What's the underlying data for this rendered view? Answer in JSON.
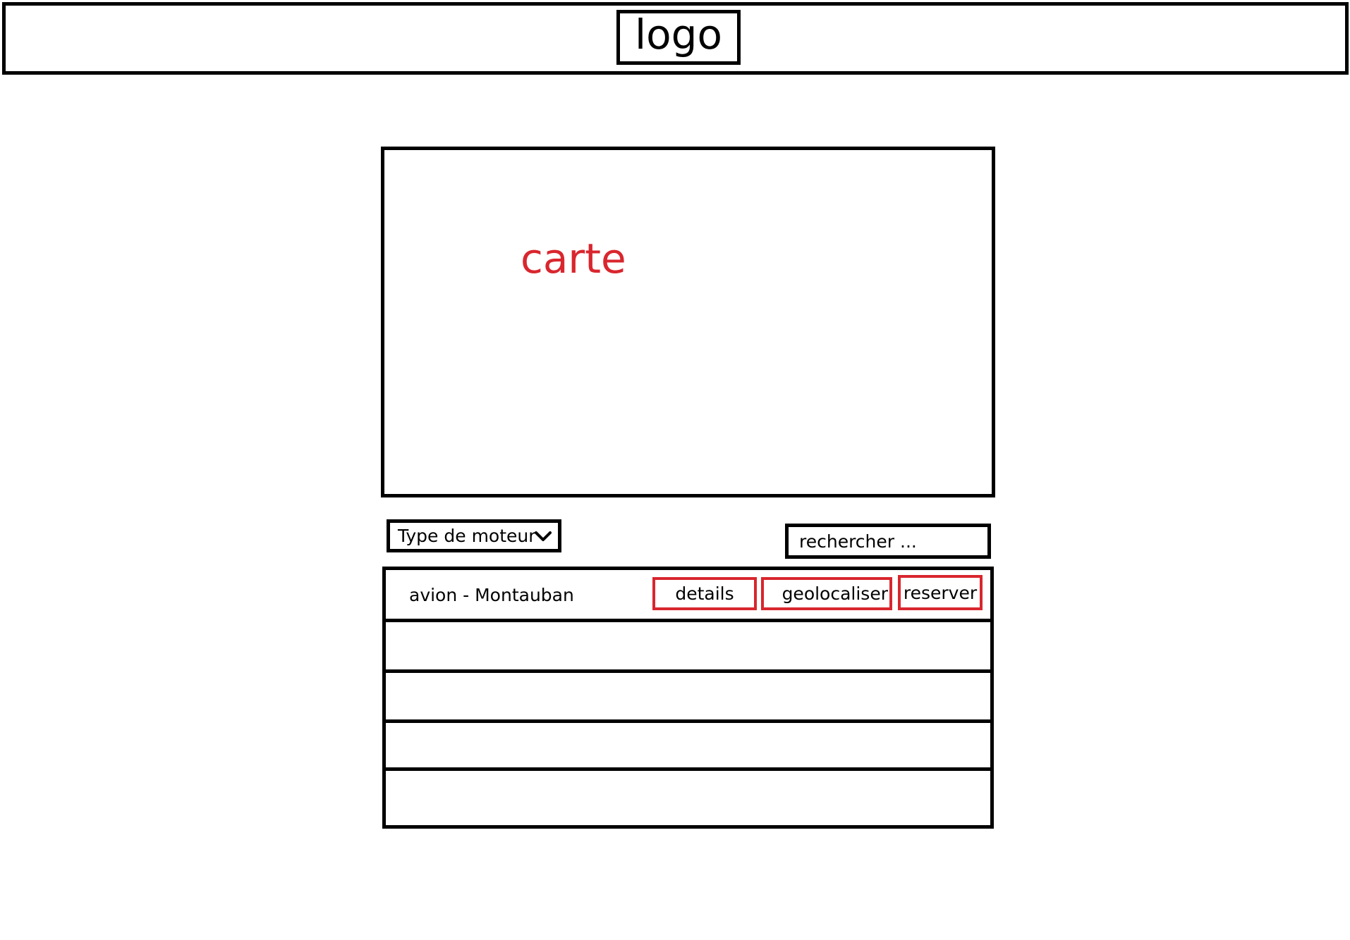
{
  "header": {
    "logo_text": "logo"
  },
  "map": {
    "label": "carte"
  },
  "filters": {
    "engine_type_label": "Type de moteur",
    "search_placeholder": "rechercher ..."
  },
  "list": {
    "rows": [
      {
        "text": "avion  - Montauban",
        "buttons": {
          "details": "details",
          "geolocate": "geolocaliser",
          "reserve": "reserver"
        }
      }
    ]
  },
  "colors": {
    "accent": "#d9262e",
    "border": "#000000"
  }
}
